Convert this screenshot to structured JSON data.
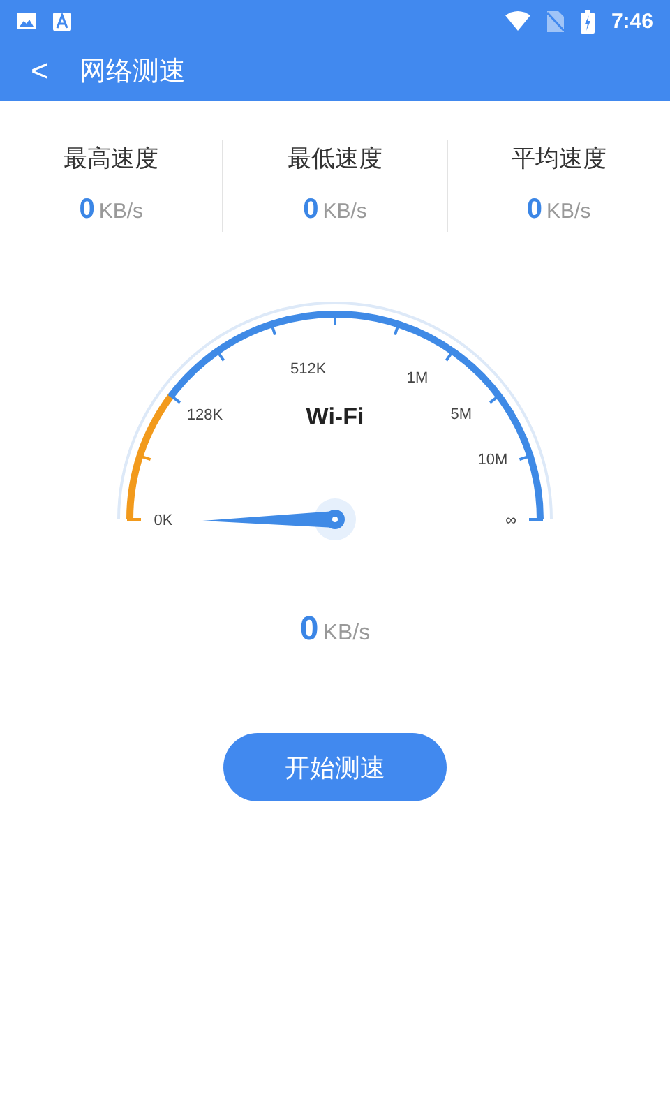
{
  "status_bar": {
    "time": "7:46"
  },
  "app_bar": {
    "back": "<",
    "title": "网络测速"
  },
  "stats": [
    {
      "label": "最高速度",
      "value": "0",
      "unit": "KB/s"
    },
    {
      "label": "最低速度",
      "value": "0",
      "unit": "KB/s"
    },
    {
      "label": "平均速度",
      "value": "0",
      "unit": "KB/s"
    }
  ],
  "gauge": {
    "title": "Wi-Fi",
    "scale": [
      "0K",
      "128K",
      "512K",
      "1M",
      "5M",
      "10M",
      "∞"
    ]
  },
  "current": {
    "value": "0",
    "unit": "KB/s"
  },
  "button": "开始测速"
}
